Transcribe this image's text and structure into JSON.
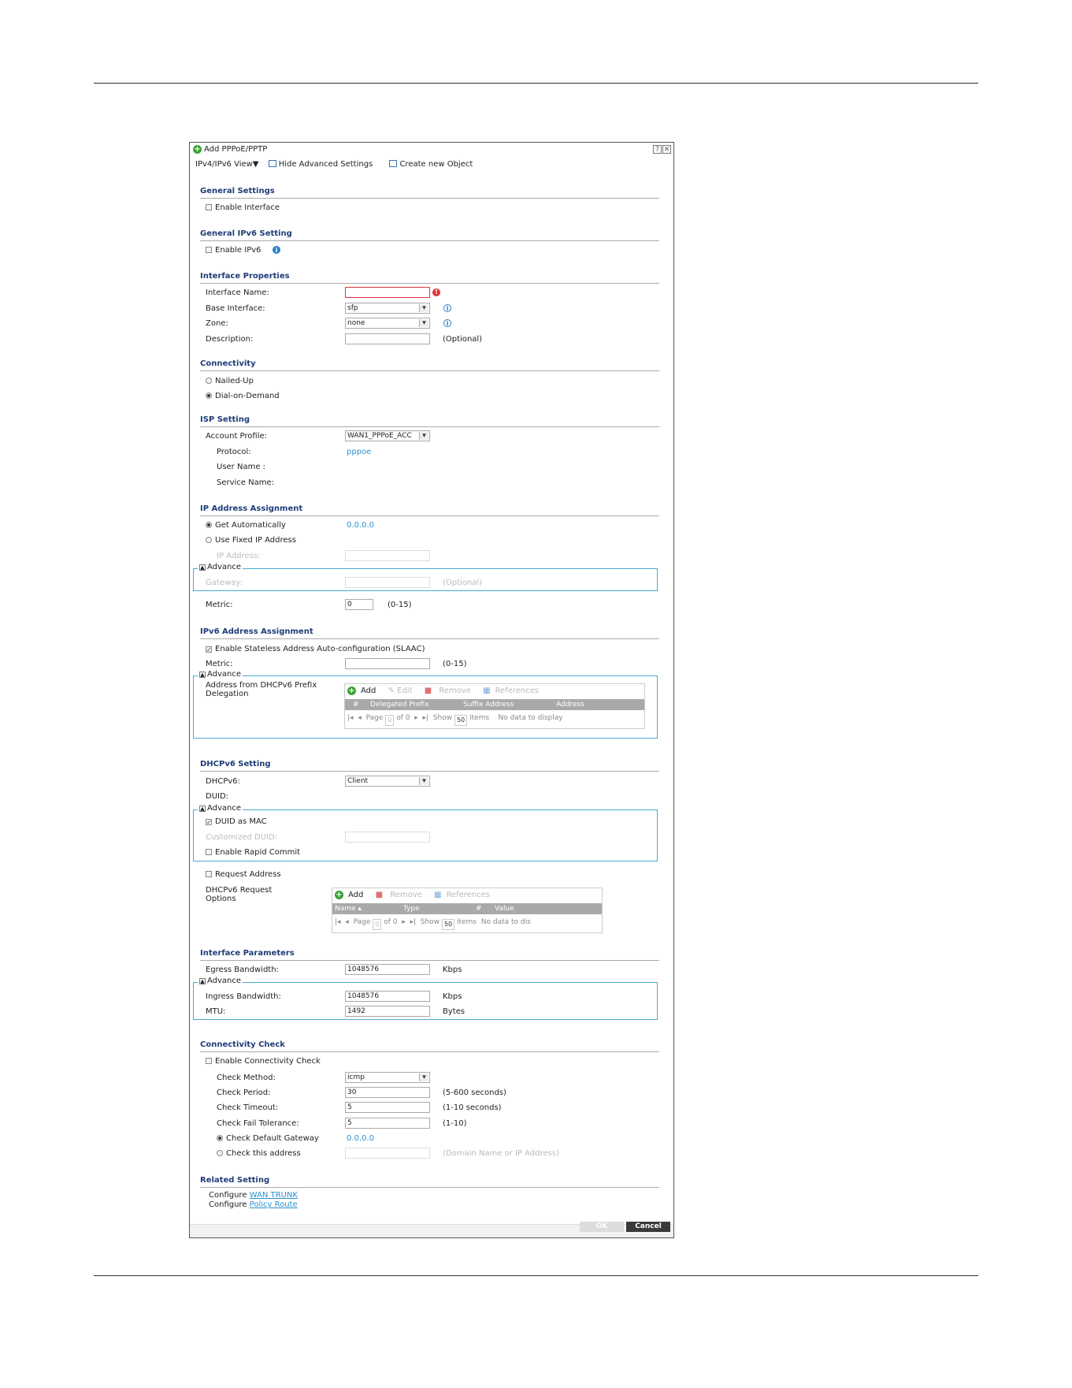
{
  "dialog": {
    "title": "Add PPPoE/PPTP",
    "help_btn": "?",
    "close_btn": "✕",
    "toolbar": {
      "view": "IPv4/IPv6 View▼",
      "hide_advanced": "Hide Advanced Settings",
      "create_object": "Create new Object"
    }
  },
  "general": {
    "title": "General Settings",
    "enable_interface": "Enable Interface"
  },
  "general_ipv6": {
    "title": "General IPv6 Setting",
    "enable_ipv6": "Enable IPv6"
  },
  "iface_props": {
    "title": "Interface Properties",
    "name_label": "Interface Name:",
    "name_value": "",
    "base_label": "Base Interface:",
    "base_value": "sfp",
    "zone_label": "Zone:",
    "zone_value": "none",
    "desc_label": "Description:",
    "desc_value": "",
    "desc_hint": "(Optional)"
  },
  "connectivity": {
    "title": "Connectivity",
    "nailed_up": "Nailed-Up",
    "dial_on_demand": "Dial-on-Demand",
    "selected": "Dial-on-Demand"
  },
  "isp": {
    "title": "ISP Setting",
    "account_label": "Account Profile:",
    "account_value": "WAN1_PPPoE_ACC",
    "protocol_label": "Protocol:",
    "protocol_value": "pppoe",
    "user_label": "User Name :",
    "service_label": "Service Name:"
  },
  "ip_assign": {
    "title": "IP Address Assignment",
    "get_auto": "Get Automatically",
    "get_auto_value": "0.0.0.0",
    "use_fixed": "Use Fixed IP Address",
    "ip_label": "IP Address:",
    "advance": "Advance",
    "gateway_label": "Gateway:",
    "gateway_hint": "(Optional)",
    "metric_label": "Metric:",
    "metric_value": "0",
    "metric_hint": "(0-15)"
  },
  "ipv6_assign": {
    "title": "IPv6 Address Assignment",
    "slaac": "Enable Stateless Address Auto-configuration (SLAAC)",
    "metric_label": "Metric:",
    "metric_hint": "(0-15)",
    "advance": "Advance",
    "prefix_label_1": "Address from DHCPv6 Prefix",
    "prefix_label_2": "Delegation",
    "grid_toolbar": [
      "Add",
      "Edit",
      "Remove",
      "References"
    ],
    "grid_columns": [
      "#",
      "Delegated Prefix",
      "Suffix Address",
      "Address"
    ],
    "pager": {
      "page": "Page",
      "page_value": "0",
      "of": "of 0",
      "show": "Show",
      "show_value": "50",
      "items": "items",
      "empty": "No data to display"
    }
  },
  "dhcpv6": {
    "title": "DHCPv6 Setting",
    "dhcpv6_label": "DHCPv6:",
    "dhcpv6_value": "Client",
    "duid_label": "DUID:",
    "advance": "Advance",
    "duid_as_mac": "DUID as MAC",
    "custom_duid": "Customized DUID:",
    "rapid_commit": "Enable Rapid Commit",
    "request_address": "Request Address",
    "req_opts_1": "DHCPv6 Request",
    "req_opts_2": "Options",
    "grid_toolbar": [
      "Add",
      "Remove",
      "References"
    ],
    "grid_columns": [
      "Name ▴",
      "Type",
      "#",
      "Value"
    ],
    "pager": {
      "page": "Page",
      "page_value": "0",
      "of": "of 0",
      "show": "Show",
      "show_value": "50",
      "items": "items",
      "empty": "No data to dis"
    }
  },
  "iface_params": {
    "title": "Interface Parameters",
    "egress_label": "Egress Bandwidth:",
    "egress_value": "1048576",
    "egress_unit": "Kbps",
    "advance": "Advance",
    "ingress_label": "Ingress Bandwidth:",
    "ingress_value": "1048576",
    "ingress_unit": "Kbps",
    "mtu_label": "MTU:",
    "mtu_value": "1492",
    "mtu_unit": "Bytes"
  },
  "conn_check": {
    "title": "Connectivity Check",
    "enable": "Enable Connectivity Check",
    "method_label": "Check Method:",
    "method_value": "icmp",
    "period_label": "Check Period:",
    "period_value": "30",
    "period_hint": "(5-600 seconds)",
    "timeout_label": "Check Timeout:",
    "timeout_value": "5",
    "timeout_hint": "(1-10 seconds)",
    "fail_label": "Check Fail Tolerance:",
    "fail_value": "5",
    "fail_hint": "(1-10)",
    "default_gw": "Check Default Gateway",
    "default_gw_value": "0.0.0.0",
    "this_addr": "Check this address",
    "this_addr_hint": "(Domain Name or IP Address)"
  },
  "related": {
    "title": "Related Setting",
    "configure": "Configure",
    "wan_trunk": "WAN TRUNK",
    "policy_route": "Policy Route"
  },
  "buttons": {
    "ok": "OK",
    "cancel": "Cancel"
  }
}
